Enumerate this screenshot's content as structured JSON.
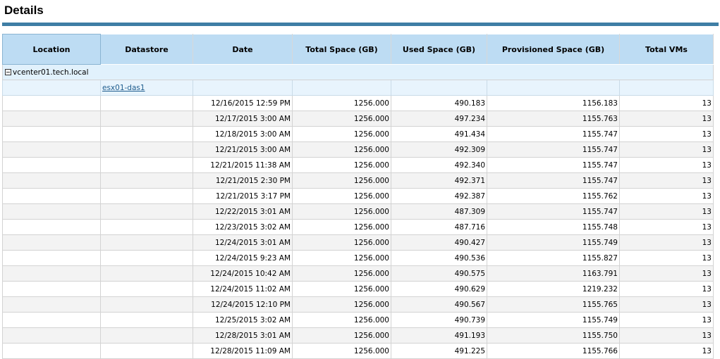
{
  "page": {
    "title": "Details"
  },
  "table": {
    "columns": [
      "Location",
      "Datastore",
      "Date",
      "Total Space (GB)",
      "Used Space (GB)",
      "Provisioned Space (GB)",
      "Total VMs"
    ],
    "group": {
      "location": "vcenter01.tech.local",
      "datastore": "esx01-das1"
    },
    "rows": [
      [
        "12/16/2015 12:59 PM",
        "1256.000",
        "490.183",
        "1156.183",
        "13"
      ],
      [
        "12/17/2015 3:00 AM",
        "1256.000",
        "497.234",
        "1155.763",
        "13"
      ],
      [
        "12/18/2015 3:00 AM",
        "1256.000",
        "491.434",
        "1155.747",
        "13"
      ],
      [
        "12/21/2015 3:00 AM",
        "1256.000",
        "492.309",
        "1155.747",
        "13"
      ],
      [
        "12/21/2015 11:38 AM",
        "1256.000",
        "492.340",
        "1155.747",
        "13"
      ],
      [
        "12/21/2015 2:30 PM",
        "1256.000",
        "492.371",
        "1155.747",
        "13"
      ],
      [
        "12/21/2015 3:17 PM",
        "1256.000",
        "492.387",
        "1155.762",
        "13"
      ],
      [
        "12/22/2015 3:01 AM",
        "1256.000",
        "487.309",
        "1155.747",
        "13"
      ],
      [
        "12/23/2015 3:02 AM",
        "1256.000",
        "487.716",
        "1155.748",
        "13"
      ],
      [
        "12/24/2015 3:01 AM",
        "1256.000",
        "490.427",
        "1155.749",
        "13"
      ],
      [
        "12/24/2015 9:23 AM",
        "1256.000",
        "490.536",
        "1155.827",
        "13"
      ],
      [
        "12/24/2015 10:42 AM",
        "1256.000",
        "490.575",
        "1163.791",
        "13"
      ],
      [
        "12/24/2015 11:02 AM",
        "1256.000",
        "490.629",
        "1219.232",
        "13"
      ],
      [
        "12/24/2015 12:10 PM",
        "1256.000",
        "490.567",
        "1155.765",
        "13"
      ],
      [
        "12/25/2015 3:02 AM",
        "1256.000",
        "490.739",
        "1155.749",
        "13"
      ],
      [
        "12/28/2015 3:01 AM",
        "1256.000",
        "491.193",
        "1155.750",
        "13"
      ],
      [
        "12/28/2015 11:09 AM",
        "1256.000",
        "491.225",
        "1155.766",
        "13"
      ]
    ]
  }
}
